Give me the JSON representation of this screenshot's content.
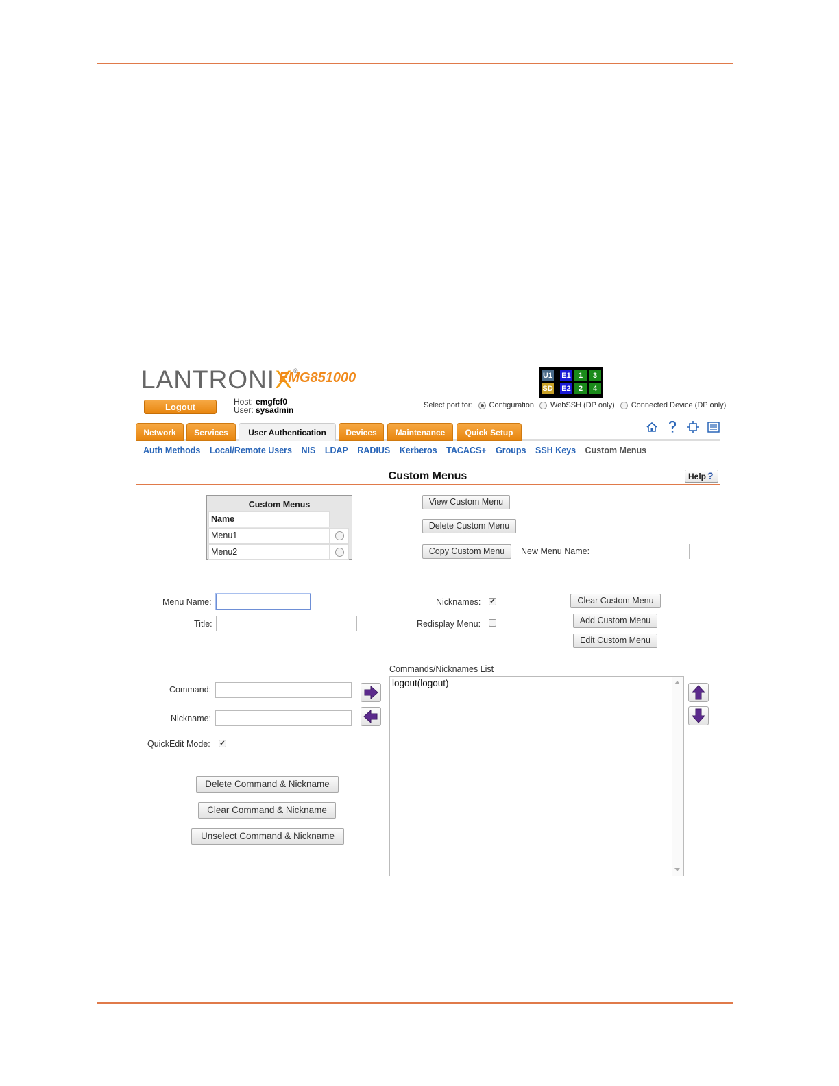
{
  "header": {
    "logo_text": "LANTRONIX",
    "logo_reg": "®",
    "model": "EMG851000",
    "logout_label": "Logout",
    "host_label": "Host:",
    "host_value": "emgfcf0",
    "user_label": "User:",
    "user_value": "sysadmin"
  },
  "port_status": {
    "cells": [
      {
        "label": "U1",
        "color": "#4a6b8a"
      },
      {
        "label": "SD",
        "color": "#c9a227"
      },
      {
        "label": "E1",
        "color": "#1a1ad6"
      },
      {
        "label": "E2",
        "color": "#1a1ad6"
      },
      {
        "label": "1",
        "color": "#1a8a1a"
      },
      {
        "label": "2",
        "color": "#1a8a1a"
      },
      {
        "label": "3",
        "color": "#1a8a1a"
      },
      {
        "label": "4",
        "color": "#1a8a1a"
      }
    ]
  },
  "port_select": {
    "label": "Select port for:",
    "options": [
      "Configuration",
      "WebSSH (DP only)",
      "Connected Device (DP only)"
    ],
    "selected": "Configuration"
  },
  "tabs": [
    "Network",
    "Services",
    "User Authentication",
    "Devices",
    "Maintenance",
    "Quick Setup"
  ],
  "active_tab": "User Authentication",
  "toolbar_icons": [
    "home-icon",
    "help-icon",
    "network-icon",
    "list-icon"
  ],
  "subnav": [
    "Auth Methods",
    "Local/Remote Users",
    "NIS",
    "LDAP",
    "RADIUS",
    "Kerberos",
    "TACACS+",
    "Groups",
    "SSH Keys",
    "Custom Menus"
  ],
  "page": {
    "title": "Custom Menus",
    "help_label": "Help",
    "help_glyph": "?"
  },
  "menus_table": {
    "caption": "Custom Menus",
    "header": "Name",
    "rows": [
      "Menu1",
      "Menu2"
    ]
  },
  "menu_actions": {
    "view": "View Custom Menu",
    "delete": "Delete Custom Menu",
    "copy": "Copy Custom Menu",
    "new_name_label": "New Menu Name:",
    "new_name_value": ""
  },
  "form": {
    "menu_name_label": "Menu Name:",
    "menu_name_value": "",
    "title_label": "Title:",
    "title_value": "",
    "nicknames_label": "Nicknames:",
    "nicknames_checked": true,
    "redisplay_label": "Redisplay Menu:",
    "redisplay_checked": false,
    "clear_menu": "Clear Custom Menu",
    "add_menu": "Add Custom Menu",
    "edit_menu": "Edit Custom Menu",
    "command_label": "Command:",
    "command_value": "",
    "nickname_label": "Nickname:",
    "nickname_value": "",
    "quickedit_label": "QuickEdit Mode:",
    "quickedit_checked": true,
    "delete_cmd": "Delete Command & Nickname",
    "clear_cmd": "Clear Command & Nickname",
    "unselect_cmd": "Unselect Command & Nickname"
  },
  "commands_list": {
    "label": "Commands/Nicknames List",
    "items": [
      "logout(logout)"
    ]
  },
  "colors": {
    "accent": "#e07a4a",
    "tab_orange": "#e8860f",
    "link_blue": "#2a66b8",
    "arrow_purple": "#5b2a8c"
  }
}
